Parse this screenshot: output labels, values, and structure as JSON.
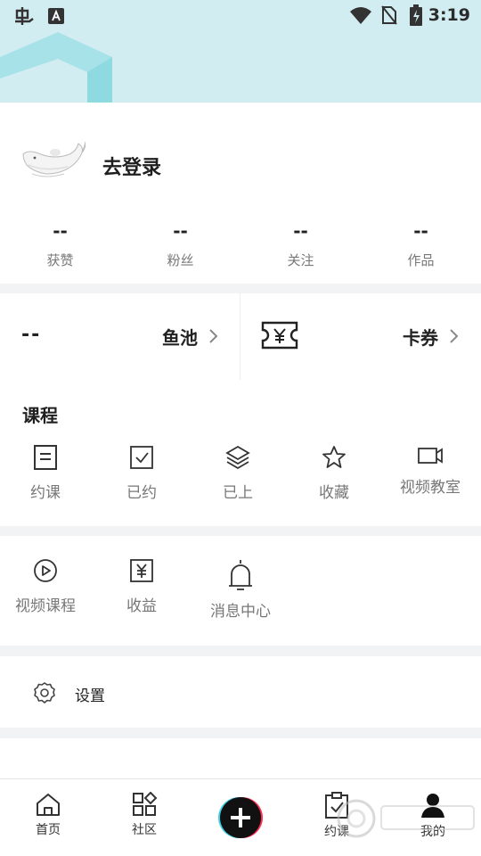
{
  "status_bar": {
    "time": "3:19",
    "left_icons": [
      "app-logo-icon",
      "keyboard-a-icon"
    ],
    "right_icons": [
      "wifi-icon",
      "no-sim-icon",
      "battery-charging-icon"
    ]
  },
  "profile": {
    "avatar_icon": "whale-avatar-icon",
    "login_text": "去登录",
    "stats": [
      {
        "value": "--",
        "label": "获赞"
      },
      {
        "value": "--",
        "label": "粉丝"
      },
      {
        "value": "--",
        "label": "关注"
      },
      {
        "value": "--",
        "label": "作品"
      }
    ]
  },
  "wallet": {
    "fishpond": {
      "value": "--",
      "label": "鱼池"
    },
    "coupon": {
      "label": "卡券",
      "icon": "ticket-yen-icon"
    }
  },
  "course": {
    "title": "课程",
    "items": [
      {
        "label": "约课",
        "icon": "book-icon"
      },
      {
        "label": "已约",
        "icon": "checkbox-icon"
      },
      {
        "label": "已上",
        "icon": "layers-icon"
      },
      {
        "label": "收藏",
        "icon": "star-icon"
      },
      {
        "label": "视频教室",
        "icon": "video-camera-icon"
      }
    ]
  },
  "services": {
    "items": [
      {
        "label": "视频课程",
        "icon": "play-circle-icon"
      },
      {
        "label": "收益",
        "icon": "yen-box-icon"
      },
      {
        "label": "消息中心",
        "icon": "bell-icon"
      }
    ]
  },
  "settings": {
    "label": "设置",
    "icon": "gear-icon"
  },
  "tabbar": {
    "items": [
      {
        "label": "首页",
        "icon": "home-icon"
      },
      {
        "label": "社区",
        "icon": "grid-icon"
      },
      {
        "label": "",
        "icon": "plus-icon"
      },
      {
        "label": "约课",
        "icon": "clipboard-check-icon"
      },
      {
        "label": "我的",
        "icon": "person-icon"
      }
    ]
  },
  "colors": {
    "header_bg": "#d2edf1",
    "hex_accent": "#a6e2e8",
    "page_bg": "#f2f3f5",
    "text_primary": "#222222",
    "text_secondary": "#777777"
  }
}
